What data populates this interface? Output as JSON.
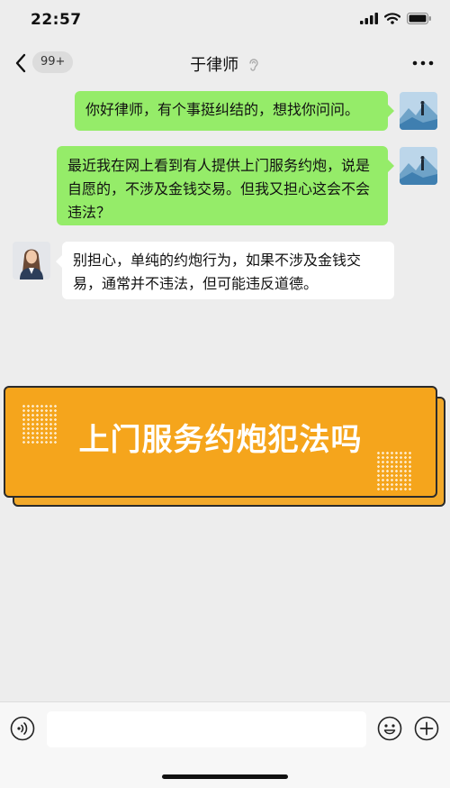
{
  "status_bar": {
    "time": "22:57"
  },
  "nav": {
    "back_badge": "99+",
    "title": "于律师"
  },
  "messages": [
    {
      "sender": "me",
      "text": "你好律师，有个事挺纠结的，想找你问问。"
    },
    {
      "sender": "me",
      "text": "最近我在网上看到有人提供上门服务约炮，说是自愿的，不涉及金钱交易。但我又担心这会不会违法？"
    },
    {
      "sender": "lawyer",
      "text": "别担心，单纯的约炮行为，如果不涉及金钱交易，通常并不违法，但可能违反道德。"
    }
  ],
  "banner": {
    "text": "上门服务约炮犯法吗"
  },
  "input_bar": {
    "value": ""
  },
  "colors": {
    "my_bubble": "#95ec69",
    "other_bubble": "#ffffff",
    "banner": "#f5a51c",
    "background": "#ededed"
  }
}
